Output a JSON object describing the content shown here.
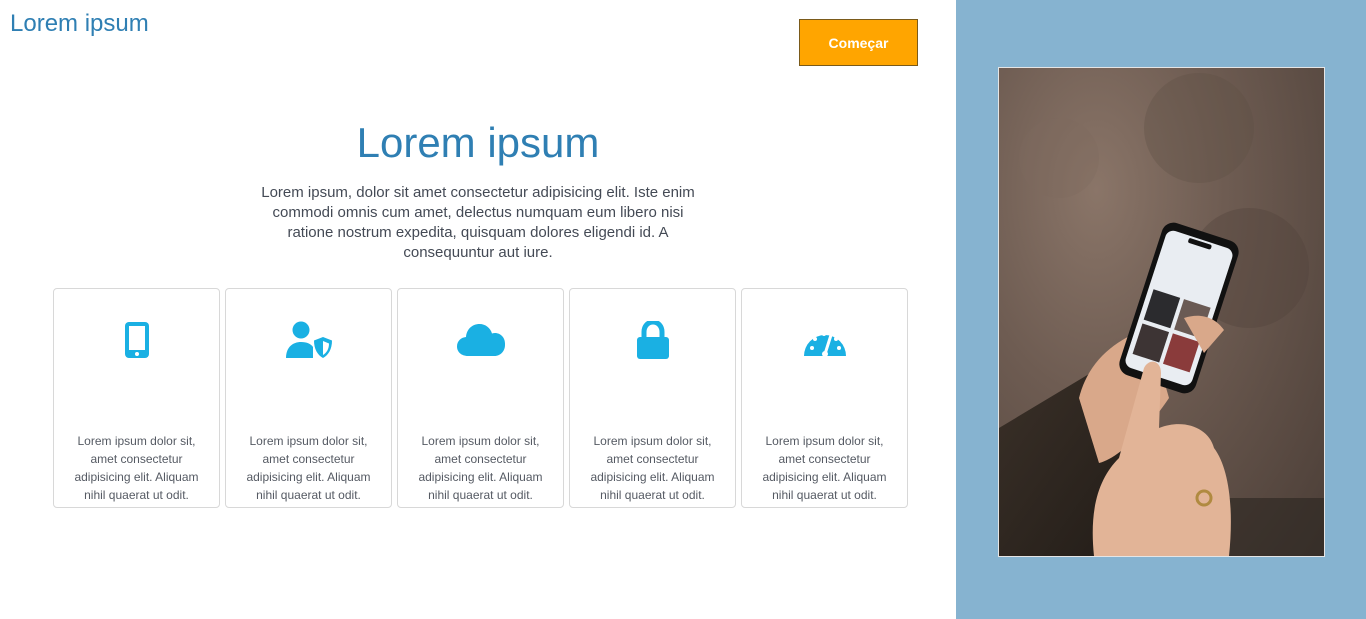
{
  "header": {
    "logo": "Lorem ipsum",
    "cta_label": "Começar"
  },
  "hero": {
    "title": "Lorem ipsum",
    "text": "Lorem ipsum, dolor sit amet consectetur adipisicing elit. Iste enim commodi omnis cum amet, delectus numquam eum libero nisi ratione nostrum expedita, quisquam dolores eligendi id. A consequuntur aut iure."
  },
  "features": [
    {
      "icon": "smartphone-icon",
      "text": "Lorem ipsum dolor sit, amet consectetur adipisicing elit. Aliquam nihil quaerat ut odit."
    },
    {
      "icon": "user-shield-icon",
      "text": "Lorem ipsum dolor sit, amet consectetur adipisicing elit. Aliquam nihil quaerat ut odit."
    },
    {
      "icon": "cloud-icon",
      "text": "Lorem ipsum dolor sit, amet consectetur adipisicing elit. Aliquam nihil quaerat ut odit."
    },
    {
      "icon": "lock-icon",
      "text": "Lorem ipsum dolor sit, amet consectetur adipisicing elit. Aliquam nihil quaerat ut odit."
    },
    {
      "icon": "speedometer-icon",
      "text": "Lorem ipsum dolor sit, amet consectetur adipisicing elit. Aliquam nihil quaerat ut odit."
    }
  ],
  "colors": {
    "brand_blue": "#2f7fb3",
    "icon_blue": "#1ab0e3",
    "cta_orange": "#ffa500",
    "side_panel": "#86b3d0"
  }
}
